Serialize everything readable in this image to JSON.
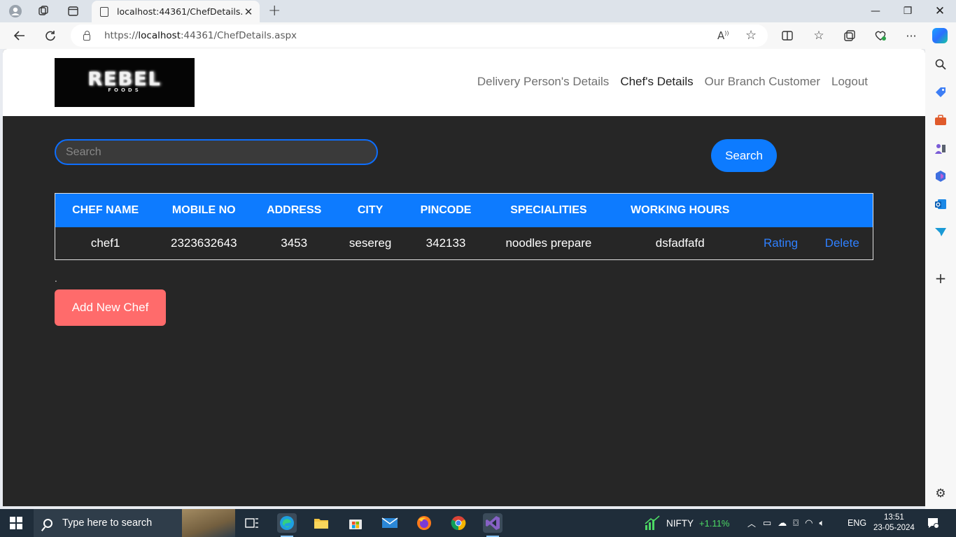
{
  "browser": {
    "tab_title": "localhost:44361/ChefDetails.aspx",
    "url_prefix": "https://",
    "url_host": "localhost",
    "url_rest": ":44361/ChefDetails.aspx"
  },
  "site": {
    "logo_text": "REBEL",
    "logo_subtext": "FOODS",
    "nav": [
      "Delivery Person's Details",
      "Chef's Details",
      "Our Branch Customer",
      "Logout"
    ],
    "active_nav_index": 1
  },
  "search": {
    "placeholder": "Search",
    "button_label": "Search"
  },
  "table": {
    "headers": [
      "CHEF NAME",
      "MOBILE NO",
      "ADDRESS",
      "CITY",
      "PINCODE",
      "SPECIALITIES",
      "WORKING HOURS"
    ],
    "rows": [
      {
        "cells": [
          "chef1",
          "2323632643",
          "3453",
          "sesereg",
          "342133",
          "noodles prepare",
          "dsfadfafd"
        ],
        "rating_label": "Rating",
        "delete_label": "Delete"
      }
    ]
  },
  "dot_text": ".",
  "add_button_label": "Add New Chef",
  "taskbar": {
    "search_placeholder": "Type here to search",
    "stock_name": "NIFTY",
    "stock_change": "+1.11%",
    "language": "ENG",
    "time": "13:51",
    "date": "23-05-2024"
  },
  "colors": {
    "accent": "#0d7bff",
    "add_button": "#ff6b6b",
    "page_bg": "#262626",
    "stock_up": "#4cd964"
  }
}
